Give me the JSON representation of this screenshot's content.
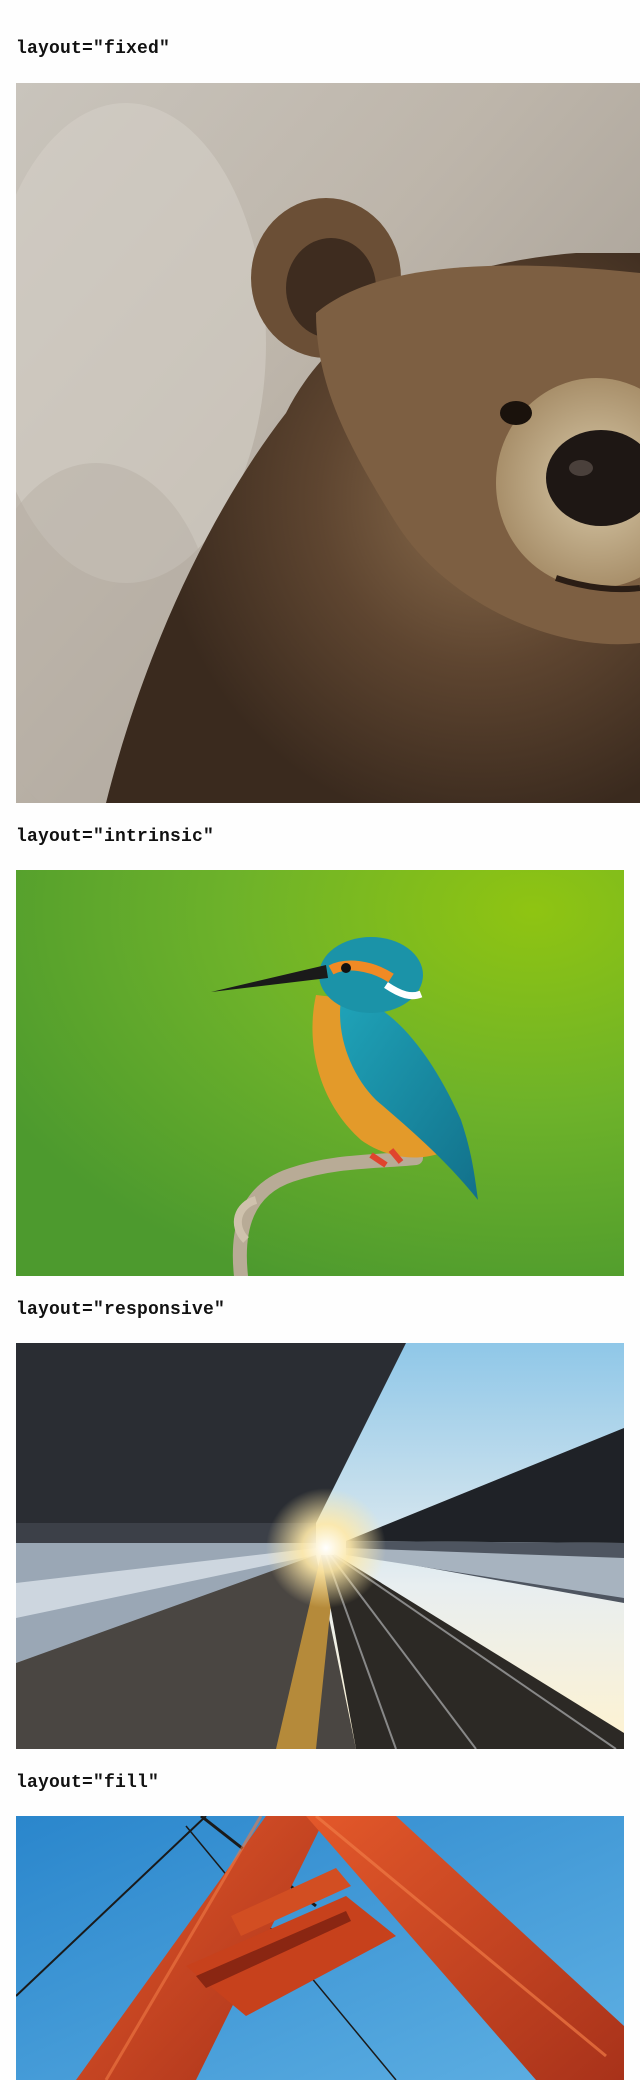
{
  "sections": [
    {
      "label": "layout=\"fixed\"",
      "image": "bear-photo"
    },
    {
      "label": "layout=\"intrinsic\"",
      "image": "kingfisher-bird-photo"
    },
    {
      "label": "layout=\"responsive\"",
      "image": "train-platform-photo"
    },
    {
      "label": "layout=\"fill\"",
      "image": "red-bridge-tower-photo"
    }
  ],
  "colors": {
    "page_background": "#fefefe",
    "label_text": "#111111",
    "kingfisher_background": "#6fb61f",
    "bridge_red": "#c8441c",
    "sky_blue": "#2f8fd0"
  }
}
